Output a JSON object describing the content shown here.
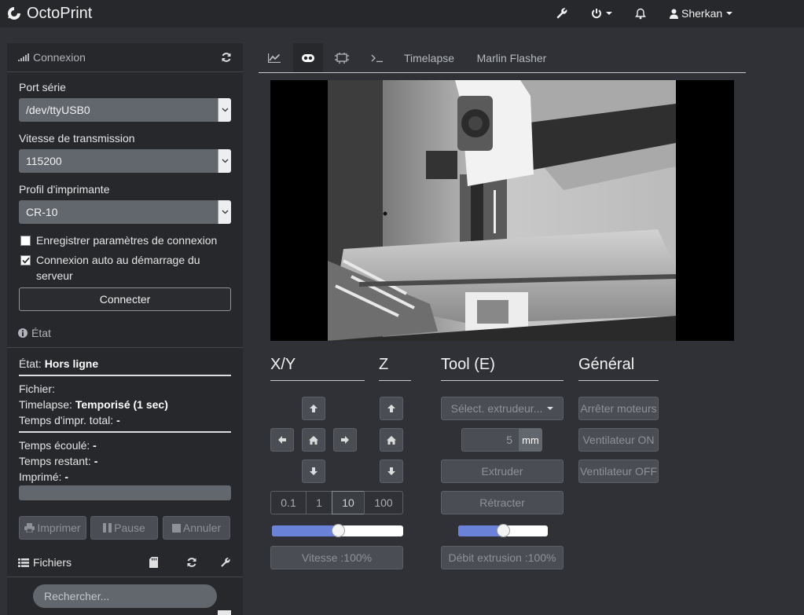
{
  "brand": {
    "name": "OctoPrint"
  },
  "user": {
    "name": "Sherkan"
  },
  "icons": {
    "topnav": [
      "wrench-icon",
      "power-icon",
      "bell-icon",
      "user-icon"
    ],
    "tabs": [
      "chart-icon",
      "webcam-icon",
      "gcode-viewer-icon",
      "terminal-icon"
    ]
  },
  "connection": {
    "title": "Connexion",
    "port_label": "Port série",
    "port_value": "/dev/ttyUSB0",
    "baud_label": "Vitesse de transmission",
    "baud_value": "115200",
    "profile_label": "Profil d'imprimante",
    "profile_value": "CR-10",
    "save_label": "Enregistrer paramètres de connexion",
    "save_checked": false,
    "auto_label_1": "Connexion auto au démarrage du",
    "auto_label_2": "serveur",
    "auto_checked": true,
    "connect_label": "Connecter"
  },
  "state": {
    "title": "État",
    "state_key": "État:",
    "state_value": "Hors ligne",
    "file_key": "Fichier:",
    "timelapse_key": "Timelapse:",
    "timelapse_value": "Temporisé (1 sec)",
    "total_key": "Temps d'impr. total:",
    "total_value": "-",
    "elapsed_key": "Temps écoulé:",
    "elapsed_value": "-",
    "remaining_key": "Temps restant:",
    "remaining_value": "-",
    "printed_key": "Imprimé:",
    "printed_value": "-",
    "progress": 0,
    "print_label": "Imprimer",
    "pause_label": "Pause",
    "cancel_label": "Annuler"
  },
  "files": {
    "title": "Fichiers",
    "search_placeholder": "Rechercher..."
  },
  "tabs": [
    {
      "label": "",
      "icon": "chart-icon"
    },
    {
      "label": "",
      "icon": "webcam-icon",
      "active": true
    },
    {
      "label": "",
      "icon": "gcode-viewer-icon"
    },
    {
      "label": "",
      "icon": "terminal-icon"
    },
    {
      "label": "Timelapse"
    },
    {
      "label": "Marlin Flasher"
    }
  ],
  "control": {
    "xy_title": "X/Y",
    "z_title": "Z",
    "tool_title": "Tool (E)",
    "general_title": "Général",
    "steps": [
      "0.1",
      "1",
      "10",
      "100"
    ],
    "active_step": "10",
    "feed_rate_label": "Vitesse :100%",
    "feed_rate_value": 100,
    "extruder_select": "Sélect. extrudeur...",
    "extrude_amount": "5",
    "extrude_unit": "mm",
    "extrude_label": "Extruder",
    "retract_label": "Rétracter",
    "flow_rate_label": "Débit extrusion :100%",
    "flow_rate_value": 100,
    "motors_off_label": "Arrêter moteurs",
    "fan_on_label": "Ventilateur ON",
    "fan_off_label": "Ventilateur OFF"
  },
  "colors": {
    "accent": "#6a83d8",
    "background": "#2f3136",
    "panel": "#26282c"
  }
}
